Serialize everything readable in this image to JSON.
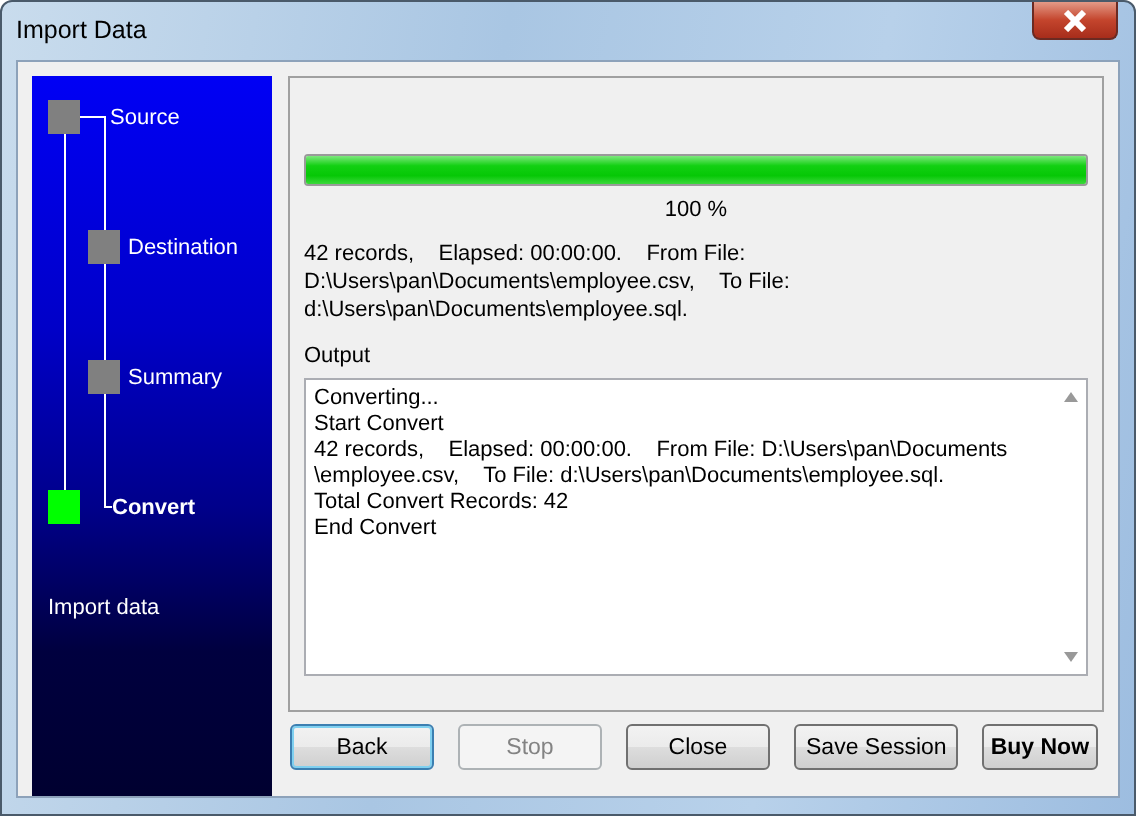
{
  "window": {
    "title": "Import Data"
  },
  "steps": [
    {
      "label": "Source",
      "current": false,
      "children": [
        {
          "label": "Destination",
          "current": false
        },
        {
          "label": "Summary",
          "current": false
        }
      ]
    },
    {
      "label": "Convert",
      "current": true
    }
  ],
  "sidebar_caption": "Import data",
  "progress": {
    "level": 1,
    "reading": "100 %"
  },
  "status_lines": [
    "42 records,    Elapsed: 00:00:00.    From File:",
    "D:\\Users\\pan\\Documents\\employee.csv,    To File:",
    "d:\\Users\\pan\\Documents\\employee.sql."
  ],
  "output": {
    "label": "Output",
    "lines": [
      "Converting...",
      "Start Convert",
      "42 records,    Elapsed: 00:00:00.    From File: D:\\Users\\pan\\Documents",
      "\\employee.csv,    To File: d:\\Users\\pan\\Documents\\employee.sql.",
      "Total Convert Records: 42",
      "End Convert"
    ]
  },
  "buttons": [
    {
      "label": "Back",
      "kind": "normal",
      "focused": true,
      "disabled": false
    },
    {
      "label": "Stop",
      "kind": "normal",
      "focused": false,
      "disabled": true
    },
    {
      "label": "Close",
      "kind": "normal",
      "focused": false,
      "disabled": false
    },
    {
      "label": "Save Session",
      "kind": "normal",
      "focused": false,
      "disabled": false
    },
    {
      "label": "Buy Now",
      "kind": "emphasis",
      "focused": false,
      "disabled": false
    }
  ]
}
